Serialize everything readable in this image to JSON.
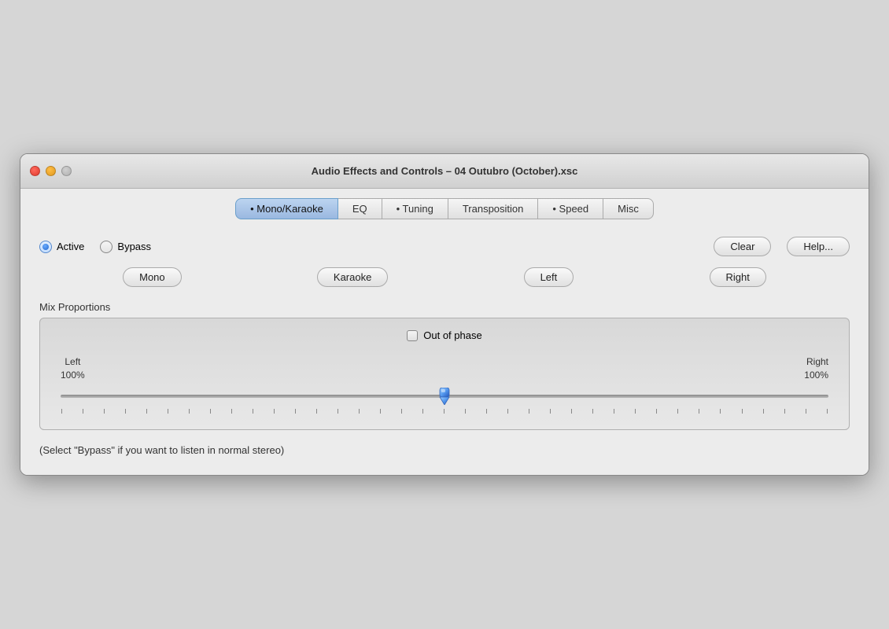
{
  "window": {
    "title": "Audio Effects and Controls – 04 Outubro (October).xsc"
  },
  "tabs": [
    {
      "id": "mono-karaoke",
      "label": "• Mono/Karaoke",
      "active": true
    },
    {
      "id": "eq",
      "label": "EQ",
      "active": false
    },
    {
      "id": "tuning",
      "label": "• Tuning",
      "active": false
    },
    {
      "id": "transposition",
      "label": "Transposition",
      "active": false
    },
    {
      "id": "speed",
      "label": "• Speed",
      "active": false
    },
    {
      "id": "misc",
      "label": "Misc",
      "active": false
    }
  ],
  "controls": {
    "active_label": "Active",
    "bypass_label": "Bypass",
    "clear_label": "Clear",
    "help_label": "Help...",
    "mono_label": "Mono",
    "karaoke_label": "Karaoke",
    "left_label": "Left",
    "right_label": "Right"
  },
  "mix": {
    "section_label": "Mix Proportions",
    "out_of_phase_label": "Out of phase",
    "left_label": "Left",
    "left_pct": "100%",
    "right_label": "Right",
    "right_pct": "100%",
    "slider_value": 50
  },
  "hint": {
    "text": "(Select \"Bypass\" if you want to listen in normal stereo)"
  },
  "ticks_count": 37
}
